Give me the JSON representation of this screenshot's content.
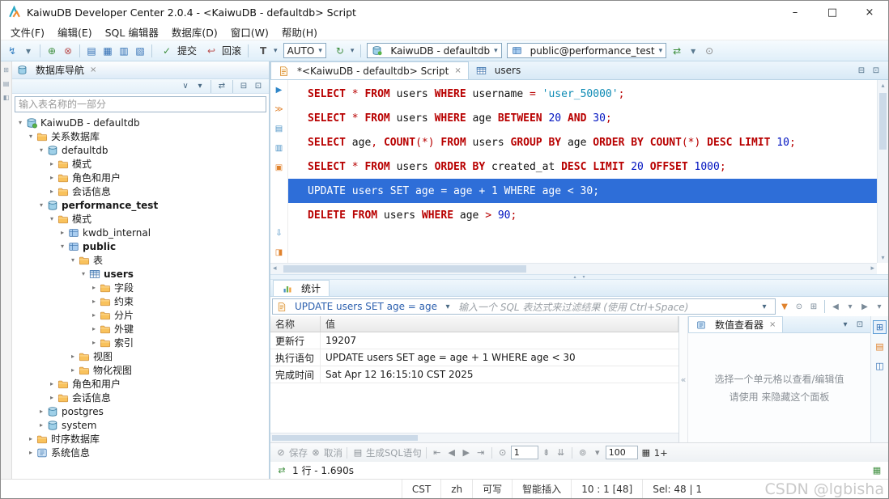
{
  "window": {
    "title": "KaiwuDB Developer Center 2.0.4 - <KaiwuDB - defaultdb> Script"
  },
  "icons": {
    "minimize": "–",
    "maximize": "□",
    "close": "×",
    "tab-close": "×",
    "dropdown": "▾",
    "scroll-up": "▴",
    "scroll-down": "▾",
    "scroll-left": "◂",
    "scroll-right": "▸",
    "split-up": "▴",
    "split-down": "▾",
    "commit": "✓",
    "rollback": "↩",
    "tx-mode": "T",
    "refresh": "↻",
    "save": "⊘",
    "cancel": "⊗",
    "gen-sql": "▤",
    "first": "⇤",
    "prev": "◀",
    "next": "▶",
    "last": "⇥",
    "goto-row": "⊙",
    "fetch-page": "⇟",
    "fetch-all": "⇊",
    "settings": "⊚",
    "memory": "▦",
    "rows-fetched": "⇄",
    "expand-left": "«"
  },
  "menu": {
    "items": [
      "文件(F)",
      "编辑(E)",
      "SQL 编辑器",
      "数据库(D)",
      "窗口(W)",
      "帮助(H)"
    ]
  },
  "toolbar": {
    "commit_label": "提交",
    "rollback_label": "回滚",
    "auto_label": "AUTO",
    "connection_value": "KaiwuDB - defaultdb",
    "schema_value": "public@performance_test",
    "icons_a": [
      {
        "n": "plug-connect-icon",
        "g": "↯",
        "c": "#2f7bbf"
      },
      {
        "n": "plug-dropdown-icon",
        "g": "▾",
        "c": "#5a7a90"
      },
      {
        "sep": true
      },
      {
        "n": "new-connection-icon",
        "g": "⊕",
        "c": "#3f8f3f"
      },
      {
        "n": "disconnect-icon",
        "g": "⊗",
        "c": "#bb5555"
      },
      {
        "sep": true
      },
      {
        "n": "open-sql-editor-icon",
        "g": "▤",
        "c": "#2f6db3"
      },
      {
        "n": "new-sql-editor-icon",
        "g": "▦",
        "c": "#2f6db3"
      },
      {
        "n": "recent-sql-icon",
        "g": "▥",
        "c": "#2f6db3"
      },
      {
        "n": "sql-console-icon",
        "g": "▧",
        "c": "#2f6db3"
      },
      {
        "sep": true
      }
    ],
    "icons_b": [
      {
        "n": "auto-sync-icon",
        "g": "⇄",
        "c": "#3f8f3f"
      },
      {
        "n": "sync-dropdown-icon",
        "g": "▾",
        "c": "#5a7a90"
      },
      {
        "n": "pin-connection-icon",
        "g": "⊙",
        "c": "#888888"
      }
    ]
  },
  "sidebar": {
    "tab_title": "数据库导航",
    "filter_placeholder": "输入表名称的一部分",
    "header_icons": [
      {
        "n": "view-menu-icon",
        "g": "∨",
        "c": "#4a6a84"
      },
      {
        "n": "view-dropdown-icon",
        "g": "▾",
        "c": "#4a6a84"
      },
      {
        "sep": true
      },
      {
        "n": "link-with-editor-icon",
        "g": "⇄",
        "c": "#4a6a84"
      },
      {
        "sep": true
      },
      {
        "n": "minimize-view-icon",
        "g": "⊟",
        "c": "#4a6a84"
      },
      {
        "n": "maximize-view-icon",
        "g": "⊡",
        "c": "#4a6a84"
      }
    ],
    "tree": [
      {
        "l": 0,
        "c": 2,
        "t": "connection",
        "label": "KaiwuDB - defaultdb"
      },
      {
        "l": 1,
        "c": 2,
        "t": "folder",
        "label": "关系数据库"
      },
      {
        "l": 2,
        "c": 2,
        "t": "database",
        "label": "defaultdb"
      },
      {
        "l": 3,
        "c": 1,
        "t": "folder",
        "label": "模式"
      },
      {
        "l": 3,
        "c": 1,
        "t": "folder",
        "label": "角色和用户"
      },
      {
        "l": 3,
        "c": 1,
        "t": "folder",
        "label": "会话信息"
      },
      {
        "l": 2,
        "c": 2,
        "t": "database",
        "label": "performance_test",
        "b": 1
      },
      {
        "l": 3,
        "c": 2,
        "t": "folder",
        "label": "模式"
      },
      {
        "l": 4,
        "c": 1,
        "t": "schema",
        "label": "kwdb_internal"
      },
      {
        "l": 4,
        "c": 2,
        "t": "schema",
        "label": "public",
        "b": 1
      },
      {
        "l": 5,
        "c": 2,
        "t": "folder",
        "label": "表"
      },
      {
        "l": 6,
        "c": 2,
        "t": "table",
        "label": "users",
        "b": 1
      },
      {
        "l": 7,
        "c": 1,
        "t": "folder",
        "label": "字段"
      },
      {
        "l": 7,
        "c": 1,
        "t": "folder",
        "label": "约束"
      },
      {
        "l": 7,
        "c": 1,
        "t": "folder",
        "label": "分片"
      },
      {
        "l": 7,
        "c": 1,
        "t": "folder",
        "label": "外键"
      },
      {
        "l": 7,
        "c": 1,
        "t": "folder",
        "label": "索引"
      },
      {
        "l": 5,
        "c": 1,
        "t": "folder",
        "label": "视图"
      },
      {
        "l": 5,
        "c": 1,
        "t": "folder",
        "label": "物化视图"
      },
      {
        "l": 3,
        "c": 1,
        "t": "folder",
        "label": "角色和用户"
      },
      {
        "l": 3,
        "c": 1,
        "t": "folder",
        "label": "会话信息"
      },
      {
        "l": 2,
        "c": 1,
        "t": "database",
        "label": "postgres"
      },
      {
        "l": 2,
        "c": 1,
        "t": "database",
        "label": "system"
      },
      {
        "l": 1,
        "c": 1,
        "t": "folder",
        "label": "时序数据库"
      },
      {
        "l": 1,
        "c": 1,
        "t": "info",
        "label": "系统信息"
      }
    ]
  },
  "editor": {
    "tab_script": "*<KaiwuDB - defaultdb> Script",
    "tab_users": "users",
    "tabbar_icons": [
      {
        "n": "minimize-editor-icon",
        "g": "⊟",
        "c": "#4a6a84"
      },
      {
        "n": "maximize-editor-icon",
        "g": "⊡",
        "c": "#4a6a84"
      }
    ],
    "gutter_top": [
      {
        "n": "execute-statement-icon",
        "g": "▶",
        "c": "#2f86c8"
      },
      {
        "n": "execute-script-icon",
        "g": "≫",
        "c": "#e0822c"
      },
      {
        "n": "explain-plan-icon",
        "g": "▤",
        "c": "#4a90c4"
      },
      {
        "n": "query-statistics-icon",
        "g": "▥",
        "c": "#4a90c4"
      },
      {
        "n": "output-console-icon",
        "g": "▣",
        "c": "#e0822c"
      }
    ],
    "gutter_bottom": [
      {
        "n": "scroll-lock-icon",
        "g": "⇩",
        "c": "#4a90c4"
      },
      {
        "n": "panel-toggle-icon",
        "g": "◨",
        "c": "#e0822c"
      }
    ],
    "lines": [
      {
        "sel": false,
        "seg": [
          [
            "k",
            "SELECT"
          ],
          [
            "o",
            " * "
          ],
          [
            "k",
            "FROM"
          ],
          [
            "i",
            " users "
          ],
          [
            "k",
            "WHERE"
          ],
          [
            "i",
            " username "
          ],
          [
            "o",
            "= "
          ],
          [
            "s",
            "'user_50000'"
          ],
          [
            "o",
            ";"
          ]
        ]
      },
      {
        "sel": false,
        "seg": [
          [
            "k",
            "SELECT"
          ],
          [
            "o",
            " * "
          ],
          [
            "k",
            "FROM"
          ],
          [
            "i",
            " users "
          ],
          [
            "k",
            "WHERE"
          ],
          [
            "i",
            " age "
          ],
          [
            "k",
            "BETWEEN"
          ],
          [
            "n",
            " 20 "
          ],
          [
            "k",
            "AND"
          ],
          [
            "n",
            " 30"
          ],
          [
            "o",
            ";"
          ]
        ]
      },
      {
        "sel": false,
        "seg": [
          [
            "k",
            "SELECT"
          ],
          [
            "i",
            " age"
          ],
          [
            "o",
            ","
          ],
          [
            "i",
            " "
          ],
          [
            "k",
            "COUNT"
          ],
          [
            "o",
            "(*)"
          ],
          [
            "i",
            " "
          ],
          [
            "k",
            "FROM"
          ],
          [
            "i",
            " users "
          ],
          [
            "k",
            "GROUP BY"
          ],
          [
            "i",
            " age "
          ],
          [
            "k",
            "ORDER BY"
          ],
          [
            "i",
            " "
          ],
          [
            "k",
            "COUNT"
          ],
          [
            "o",
            "(*)"
          ],
          [
            "i",
            " "
          ],
          [
            "k",
            "DESC"
          ],
          [
            "i",
            " "
          ],
          [
            "k",
            "LIMIT"
          ],
          [
            "n",
            " 10"
          ],
          [
            "o",
            ";"
          ]
        ]
      },
      {
        "sel": false,
        "seg": [
          [
            "k",
            "SELECT"
          ],
          [
            "o",
            " * "
          ],
          [
            "k",
            "FROM"
          ],
          [
            "i",
            " users "
          ],
          [
            "k",
            "ORDER BY"
          ],
          [
            "i",
            " created_at "
          ],
          [
            "k",
            "DESC"
          ],
          [
            "i",
            " "
          ],
          [
            "k",
            "LIMIT"
          ],
          [
            "n",
            " 20 "
          ],
          [
            "k",
            "OFFSET"
          ],
          [
            "n",
            " 1000"
          ],
          [
            "o",
            ";"
          ]
        ]
      },
      {
        "sel": true,
        "seg": [
          [
            "w",
            "UPDATE users SET age = age + 1 WHERE age < 30;"
          ]
        ]
      },
      {
        "sel": false,
        "seg": [
          [
            "k",
            "DELETE"
          ],
          [
            "i",
            " "
          ],
          [
            "k",
            "FROM"
          ],
          [
            "i",
            " users "
          ],
          [
            "k",
            "WHERE"
          ],
          [
            "i",
            " age "
          ],
          [
            "o",
            "> "
          ],
          [
            "n",
            "90"
          ],
          [
            "o",
            ";"
          ]
        ]
      }
    ]
  },
  "stats": {
    "tab_label": "统计",
    "query_ref": "UPDATE users SET age = age",
    "filter_placeholder": "输入一个 SQL 表达式来过滤结果 (使用 Ctrl+Space)",
    "filter_icons": [
      {
        "n": "apply-filter-icon",
        "g": "▼",
        "c": "#e0822c"
      },
      {
        "n": "filter-settings-icon",
        "g": "⊙",
        "c": "#7a8a98"
      },
      {
        "n": "save-filter-icon",
        "g": "⊞",
        "c": "#7a8a98"
      },
      {
        "sep": true
      },
      {
        "n": "history-back-icon",
        "g": "◀",
        "c": "#7a8a98"
      },
      {
        "n": "history-back-dropdown-icon",
        "g": "▾",
        "c": "#7a8a98"
      },
      {
        "n": "history-forward-icon",
        "g": "▶",
        "c": "#7a8a98"
      },
      {
        "n": "history-forward-dropdown-icon",
        "g": "▾",
        "c": "#7a8a98"
      }
    ],
    "columns": [
      "名称",
      "值"
    ],
    "rows": [
      [
        "更新行",
        "19207"
      ],
      [
        "执行语句",
        "UPDATE users SET age = age + 1 WHERE age < 30"
      ],
      [
        "完成时间",
        "Sat Apr 12 16:15:10 CST 2025"
      ]
    ],
    "value_viewer_tab": "数值查看器",
    "value_viewer_icons": [
      {
        "n": "value-viewer-menu-icon",
        "g": "▾",
        "c": "#4a6a84"
      },
      {
        "n": "value-viewer-maximize-icon",
        "g": "⊡",
        "c": "#4a6a84"
      }
    ],
    "side_strip_icons": [
      {
        "n": "grid-view-icon",
        "g": "⊞",
        "c": "#2f6db3",
        "selected": true
      },
      {
        "n": "text-view-icon",
        "g": "▤",
        "c": "#e0822c"
      },
      {
        "n": "browse-view-icon",
        "g": "◫",
        "c": "#2f6db3"
      }
    ],
    "hint1": "选择一个单元格以查看/编辑值",
    "hint2": "请使用 来隐藏这个面板",
    "save_label": "保存",
    "cancel_label": "取消",
    "generate_label": "生成SQL语句",
    "row_input": "1",
    "fetch_input": "100",
    "more_label": "1+",
    "result_status": "1 行 - 1.690s"
  },
  "status_bar": {
    "segments": [
      "CST",
      "zh",
      "可写",
      "智能插入",
      "10 : 1 [48]",
      "Sel: 48 | 1"
    ],
    "watermark": "CSDN @lgbisha"
  }
}
